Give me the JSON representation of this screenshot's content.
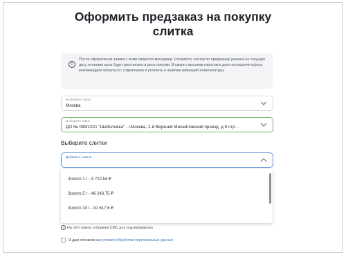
{
  "page": {
    "title_line1": "Оформить предзаказ на покупку",
    "title_line2": "слитка"
  },
  "notice": {
    "icon": "info-icon",
    "text": "После оформления заявки с вами свяжется менеджер. Стоимость слитка по предзаказу указана на текущую дату, итоговая цена будет рассчитана в день покупки. В связи с высоким спросом в день посещения офиса рекомендуем связаться с отделением и уточнить о наличии имеющей номенклатуры"
  },
  "city_field": {
    "label": "Выберите город",
    "value": "Москва",
    "icon": "chevron-down-icon"
  },
  "office_field": {
    "label": "Выберите офис",
    "value": "ДО № 099/1021 \"Шаболовка\" - г.Москва, 2-й Верхний Михайловский проезд, д.9 стр…",
    "icon": "chevron-down-icon"
  },
  "bars_section": {
    "heading": "Выберите слитки",
    "field_label": "Добавить слиток",
    "icon": "chevron-up-icon"
  },
  "dropdown": {
    "options": [
      "Золото 1 г - 9 722,64 ₽",
      "Золото 5 г - 46 243,75 ₽",
      "Золото 10 г - 91 617,6 ₽"
    ]
  },
  "sms_note": {
    "icon": "info-icon",
    "text": "На этот номер отправим СМС для подтверждения"
  },
  "consent": {
    "prefix": "Я даю согласие на ",
    "link": "условия обработки персональных данных"
  }
}
